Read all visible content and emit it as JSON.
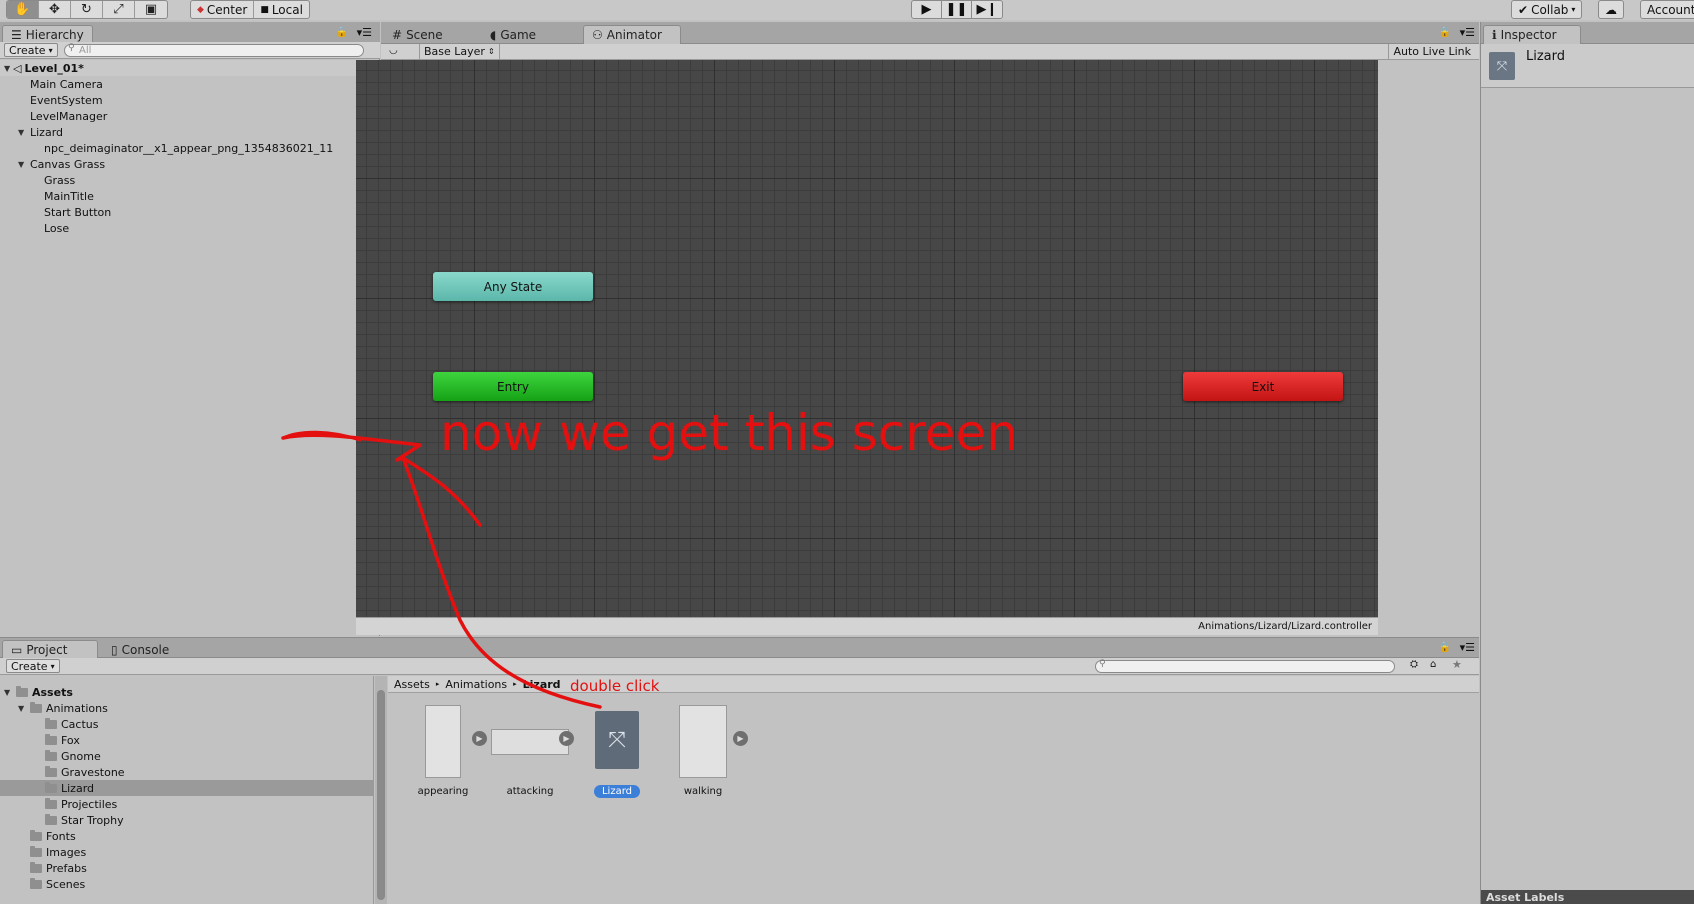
{
  "toolbar": {
    "tools": [
      "hand-tool",
      "move-tool",
      "rotate-tool",
      "scale-tool",
      "rect-tool"
    ],
    "pivot_label": "Center",
    "space_label": "Local",
    "collab_label": "Collab",
    "account_label": "Account"
  },
  "hierarchy": {
    "tab_label": "Hierarchy",
    "create_label": "Create",
    "search_placeholder": "All",
    "scene_name": "Level_01*",
    "items": [
      {
        "label": "Main Camera"
      },
      {
        "label": "EventSystem"
      },
      {
        "label": "LevelManager"
      },
      {
        "label": "Lizard"
      },
      {
        "label": "npc_deimaginator__x1_appear_png_1354836021_11"
      },
      {
        "label": "Canvas Grass"
      },
      {
        "label": "Grass"
      },
      {
        "label": "MainTitle"
      },
      {
        "label": "Start Button"
      },
      {
        "label": "Lose"
      }
    ]
  },
  "center_tabs": [
    {
      "label": "Scene",
      "icon": "hash-icon"
    },
    {
      "label": "Game",
      "icon": "pacman-icon"
    },
    {
      "label": "Animator",
      "icon": "animator-icon"
    }
  ],
  "animator": {
    "layer_label": "Base Layer",
    "auto_live_link": "Auto Live Link",
    "states": {
      "any_state": "Any State",
      "entry": "Entry",
      "exit": "Exit"
    },
    "footer_path": "Animations/Lizard/Lizard.controller",
    "colors": {
      "any_state": "#6cc4b8",
      "entry": "#1fb51f",
      "exit": "#d61c1c"
    }
  },
  "inspector": {
    "tab_label": "Inspector",
    "object_name": "Lizard",
    "asset_labels": "Asset Labels"
  },
  "project": {
    "tabs": [
      {
        "label": "Project"
      },
      {
        "label": "Console"
      }
    ],
    "create_label": "Create",
    "tree": [
      {
        "label": "Assets"
      },
      {
        "label": "Animations"
      },
      {
        "label": "Cactus"
      },
      {
        "label": "Fox"
      },
      {
        "label": "Gnome"
      },
      {
        "label": "Gravestone"
      },
      {
        "label": "Lizard"
      },
      {
        "label": "Projectiles"
      },
      {
        "label": "Star Trophy"
      },
      {
        "label": "Fonts"
      },
      {
        "label": "Images"
      },
      {
        "label": "Prefabs"
      },
      {
        "label": "Scenes"
      }
    ],
    "breadcrumb": [
      "Assets",
      "Animations",
      "Lizard"
    ],
    "assets": [
      {
        "label": "appearing"
      },
      {
        "label": "attacking"
      },
      {
        "label": "Lizard"
      },
      {
        "label": "walking"
      }
    ]
  },
  "annotations": {
    "main_note": "now we get this screen",
    "double_click": "double click",
    "ink_color": "#e41010"
  }
}
